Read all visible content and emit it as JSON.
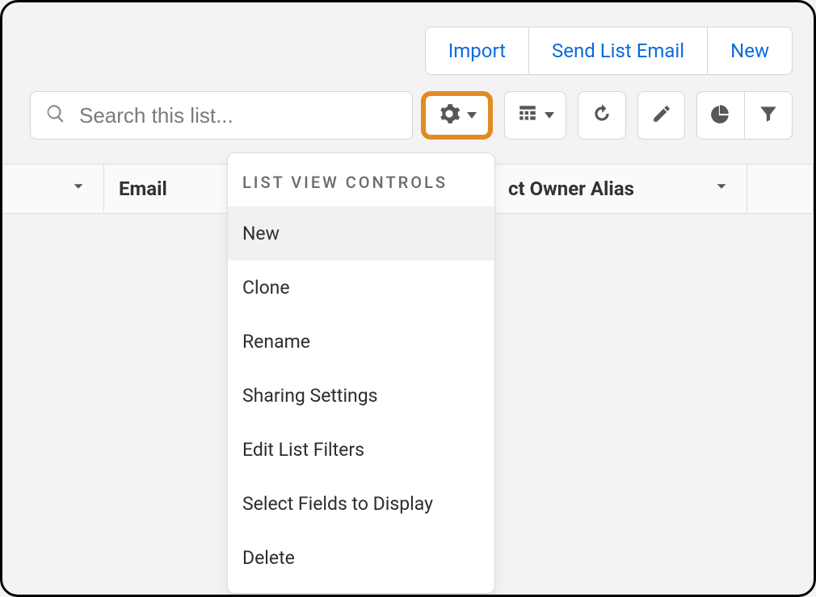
{
  "actions": {
    "import": "Import",
    "send_list_email": "Send List Email",
    "new": "New"
  },
  "search": {
    "placeholder": "Search this list..."
  },
  "columns": {
    "email": "Email",
    "owner_alias_visible": "ct Owner Alias"
  },
  "dropdown": {
    "header": "LIST VIEW CONTROLS",
    "items": [
      "New",
      "Clone",
      "Rename",
      "Sharing Settings",
      "Edit List Filters",
      "Select Fields to Display",
      "Delete"
    ]
  }
}
